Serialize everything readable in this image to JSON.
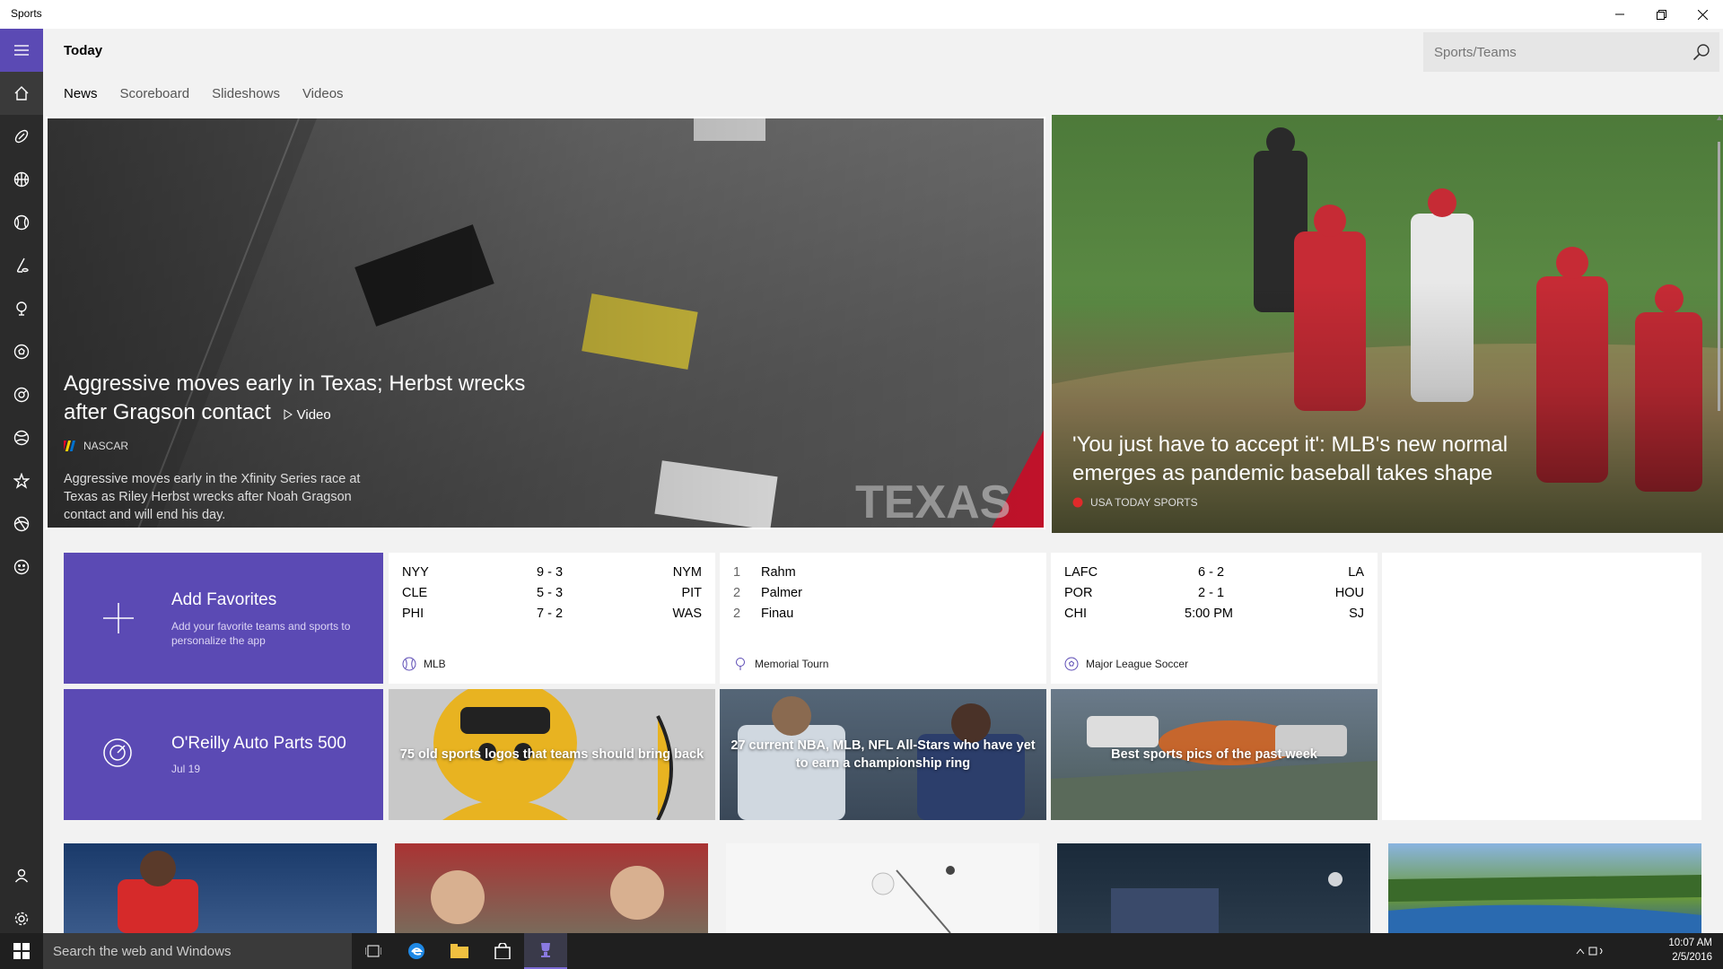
{
  "window": {
    "title": "Sports"
  },
  "header": {
    "title": "Today",
    "tabs": [
      {
        "label": "News",
        "active": true
      },
      {
        "label": "Scoreboard",
        "active": false
      },
      {
        "label": "Slideshows",
        "active": false
      },
      {
        "label": "Videos",
        "active": false
      }
    ],
    "search_placeholder": "Sports/Teams"
  },
  "rail": {
    "items": [
      "hamburger-icon",
      "home-icon",
      "football-icon",
      "basketball-icon",
      "baseball-icon",
      "hockey-icon",
      "golf-icon",
      "soccer-icon",
      "motorsport-icon",
      "tennis-icon",
      "favorites-icon",
      "sports-icon",
      "fantasy-icon",
      "account-icon",
      "settings-icon"
    ]
  },
  "hero_left": {
    "headline": "Aggressive moves early in Texas; Herbst wrecks after Gragson contact",
    "video_label": "Video",
    "source": "NASCAR",
    "description": "Aggressive moves early in the Xfinity Series race at Texas as Riley Herbst wrecks after Noah Gragson contact and will end his day."
  },
  "hero_right": {
    "headline": "'You just have to accept it': MLB's new normal emerges as pandemic baseball takes shape",
    "source": "USA TODAY SPORTS"
  },
  "add_favorites": {
    "title": "Add Favorites",
    "subtitle": "Add your favorite teams and sports to personalize the app"
  },
  "event_tile": {
    "title": "O'Reilly Auto Parts 500",
    "date": "Jul 19"
  },
  "mlb": {
    "league": "MLB",
    "rows": [
      {
        "home": "NYY",
        "score": "9 - 3",
        "away": "NYM"
      },
      {
        "home": "CLE",
        "score": "5 - 3",
        "away": "PIT"
      },
      {
        "home": "PHI",
        "score": "7 - 2",
        "away": "WAS"
      }
    ]
  },
  "golf": {
    "tournament": "Memorial Tourn",
    "rows": [
      {
        "pos": "1",
        "name": "Rahm"
      },
      {
        "pos": "2",
        "name": "Palmer"
      },
      {
        "pos": "2",
        "name": "Finau"
      }
    ]
  },
  "mls": {
    "league": "Major League Soccer",
    "rows": [
      {
        "home": "LAFC",
        "score": "6 - 2",
        "away": "LA"
      },
      {
        "home": "POR",
        "score": "2 - 1",
        "away": "HOU"
      },
      {
        "home": "CHI",
        "score": "5:00 PM",
        "away": "SJ"
      }
    ]
  },
  "photo_tiles": [
    {
      "caption": "75 old sports logos that teams should bring back"
    },
    {
      "caption": "27 current NBA, MLB, NFL All-Stars who have yet to earn a championship ring"
    },
    {
      "caption": "Best sports pics of the past week"
    }
  ],
  "taskbar": {
    "search_placeholder": "Search the web and Windows",
    "time": "10:07 AM",
    "date": "2/5/2016"
  },
  "colors": {
    "accent": "#5b4ab4",
    "rail": "#2b2b2b",
    "background": "#f2f2f2"
  }
}
